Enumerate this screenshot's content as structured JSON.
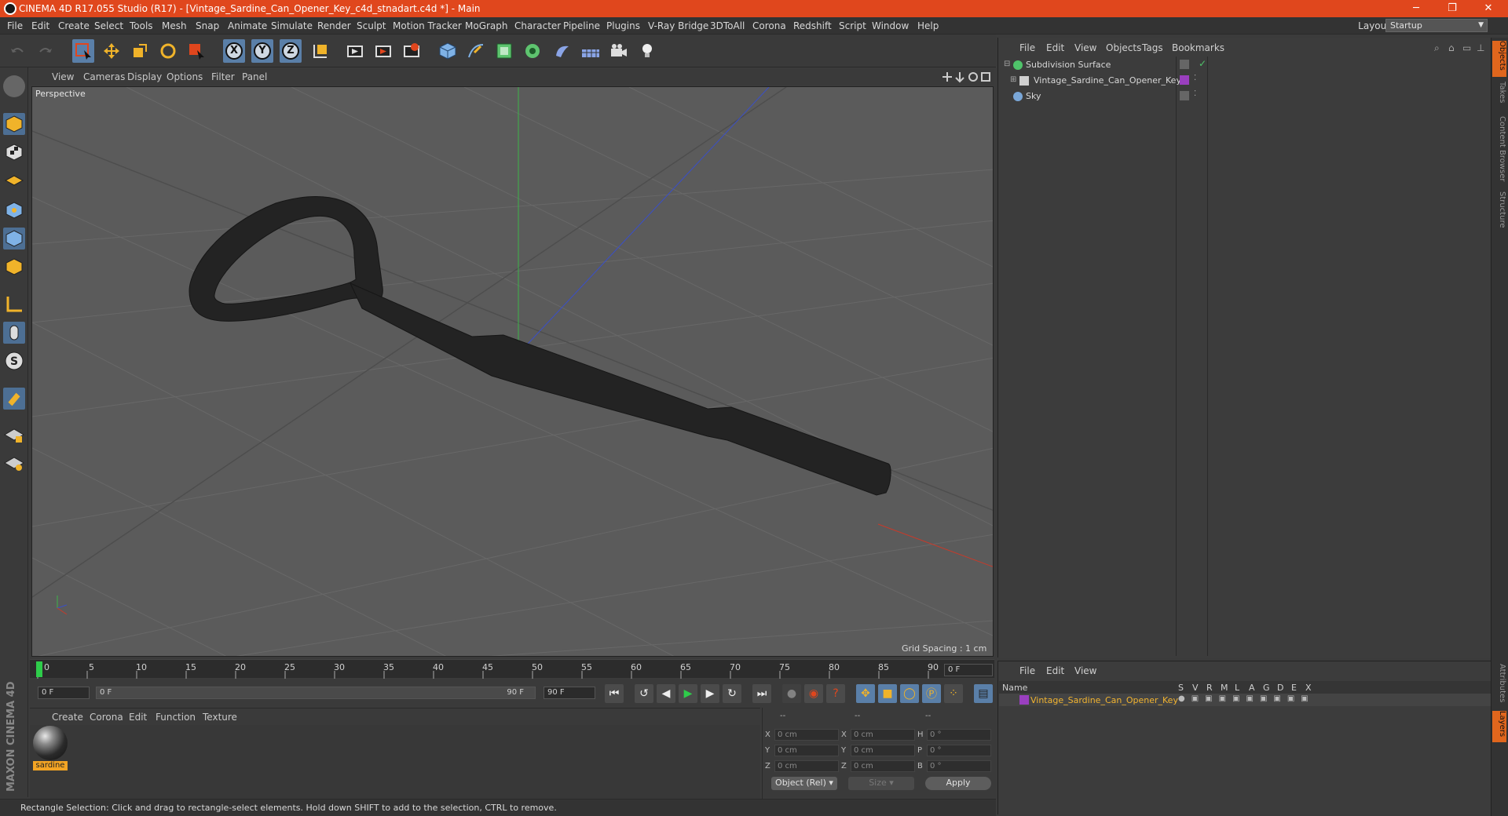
{
  "titlebar": {
    "title": "CINEMA 4D R17.055 Studio (R17) - [Vintage_Sardine_Can_Opener_Key_c4d_stnadart.c4d *] - Main",
    "minimize": "─",
    "restore": "❐",
    "close": "✕"
  },
  "menu": [
    "File",
    "Edit",
    "Create",
    "Select",
    "Tools",
    "Mesh",
    "Snap",
    "Animate",
    "Simulate",
    "Render",
    "Sculpt",
    "Motion Tracker",
    "MoGraph",
    "Character",
    "Pipeline",
    "Plugins",
    "V-Ray Bridge",
    "3DToAll",
    "Corona",
    "Redshift",
    "Script",
    "Window",
    "Help"
  ],
  "layout": {
    "label": "Layout:",
    "value": "Startup"
  },
  "toolbar": {
    "axis_x": "X",
    "axis_y": "Y",
    "axis_z": "Z"
  },
  "viewport": {
    "menu": [
      "View",
      "Cameras",
      "Display",
      "Options",
      "Filter",
      "Panel"
    ],
    "camera_label": "Perspective",
    "grid_spacing": "Grid Spacing : 1 cm"
  },
  "timeline": {
    "ticks": [
      "0",
      "5",
      "10",
      "15",
      "20",
      "25",
      "30",
      "35",
      "40",
      "45",
      "50",
      "55",
      "60",
      "65",
      "70",
      "75",
      "80",
      "85",
      "90"
    ],
    "current_frame": "0 F",
    "start_field": "0 F",
    "range_start": "0 F",
    "range_end": "90 F",
    "end_field": "90 F"
  },
  "material_manager": {
    "menu": [
      "Create",
      "Corona",
      "Edit",
      "Function",
      "Texture"
    ],
    "materials": [
      {
        "name": "sardine"
      }
    ]
  },
  "coordinates": {
    "headers": [
      "--",
      "--",
      "--"
    ],
    "rows": [
      {
        "a": "X",
        "a_val": "0 cm",
        "b": "X",
        "b_val": "0 cm",
        "c": "H",
        "c_val": "0 °"
      },
      {
        "a": "Y",
        "a_val": "0 cm",
        "b": "Y",
        "b_val": "0 cm",
        "c": "P",
        "c_val": "0 °"
      },
      {
        "a": "Z",
        "a_val": "0 cm",
        "b": "Z",
        "b_val": "0 cm",
        "c": "B",
        "c_val": "0 °"
      }
    ],
    "mode": "Object (Rel)",
    "size": "Size",
    "apply": "Apply"
  },
  "status": "Rectangle Selection: Click and drag to rectangle-select elements. Hold down SHIFT to add to the selection, CTRL to remove.",
  "object_manager": {
    "menu": [
      "File",
      "Edit",
      "View",
      "Objects",
      "Tags",
      "Bookmarks"
    ],
    "objects": [
      {
        "name": "Subdivision Surface",
        "color": "#4fc36a"
      },
      {
        "name": "Vintage_Sardine_Can_Opener_Key",
        "color": "#cfcfcf"
      },
      {
        "name": "Sky",
        "color": "#7aa7d8"
      }
    ]
  },
  "layer_manager": {
    "menu": [
      "File",
      "Edit",
      "View"
    ],
    "headers": [
      "Name",
      "S",
      "V",
      "R",
      "M",
      "L",
      "A",
      "G",
      "D",
      "E",
      "X"
    ],
    "layers": [
      {
        "name": "Vintage_Sardine_Can_Opener_Key",
        "color": "#9a3fbf"
      }
    ]
  },
  "side_tabs": [
    "Objects",
    "Takes",
    "Content Browser",
    "Structure",
    "Attributes",
    "Layers"
  ],
  "brand": "MAXON CINEMA 4D"
}
